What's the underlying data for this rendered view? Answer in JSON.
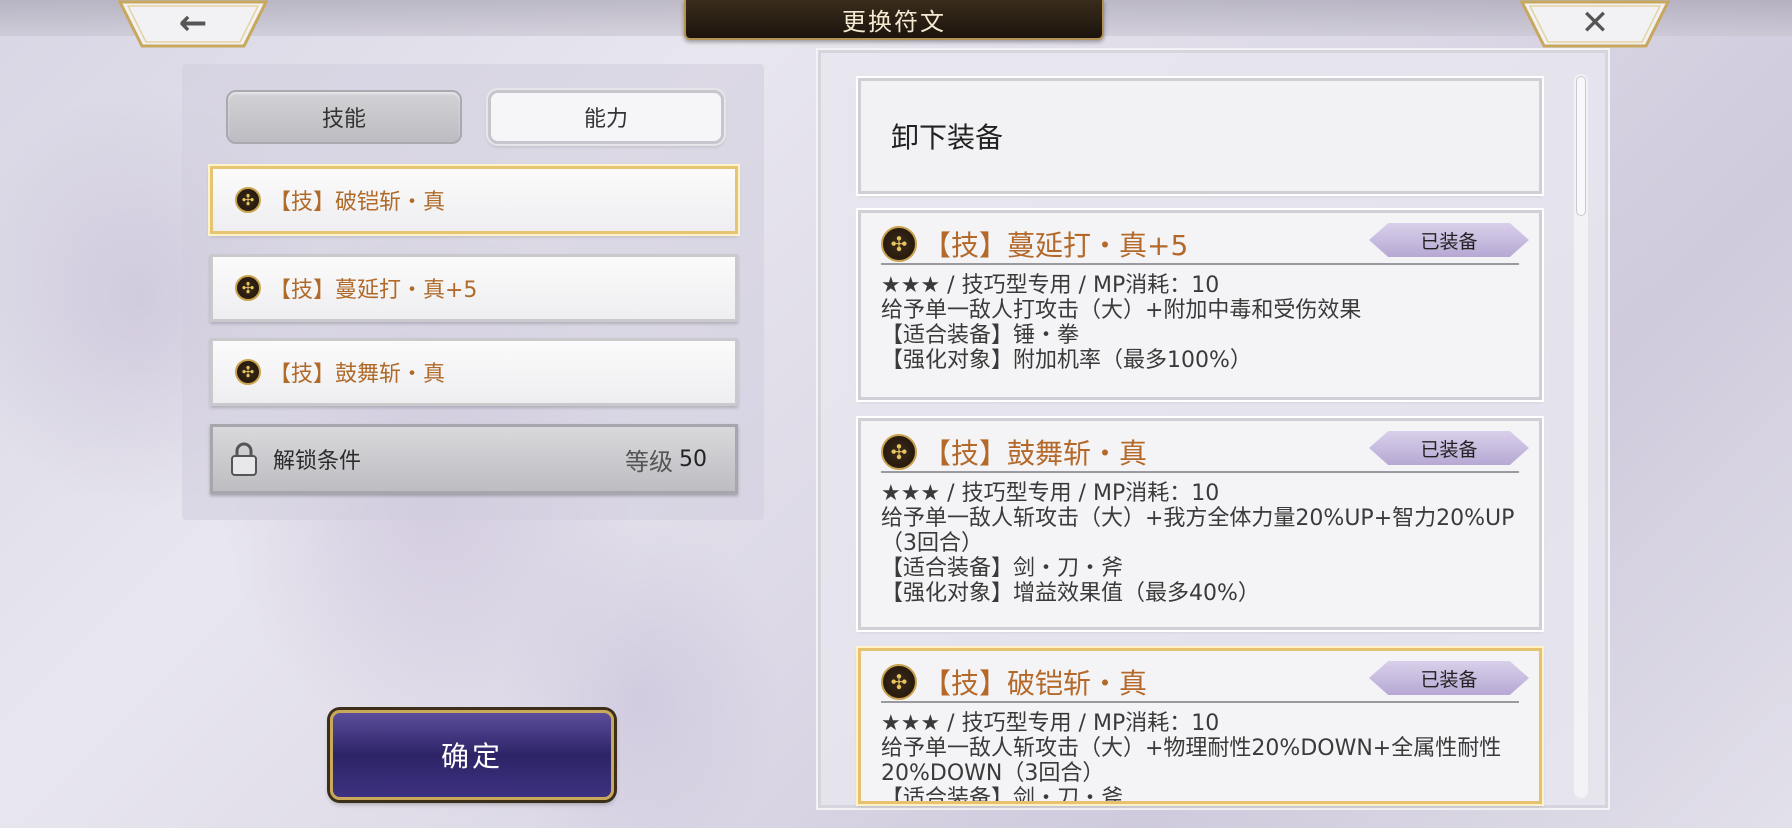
{
  "header": {
    "title": "更换符文",
    "back_glyph": "←",
    "close_glyph": "✕"
  },
  "tabs": [
    {
      "label": "技能",
      "active": false
    },
    {
      "label": "能力",
      "active": true
    }
  ],
  "slots": [
    {
      "icon": "rune-icon",
      "label": "【技】破铠斩・真",
      "selected": true
    },
    {
      "icon": "rune-icon",
      "label": "【技】蔓延打・真+5",
      "selected": false
    },
    {
      "icon": "rune-icon",
      "label": "【技】鼓舞斩・真",
      "selected": false
    }
  ],
  "lock": {
    "label": "解锁条件",
    "level_label": "等级",
    "level_value": "50"
  },
  "confirm_label": "确定",
  "unequip_label": "卸下装备",
  "cards": [
    {
      "name": "【技】蔓延打・真+5",
      "badge": "已装备",
      "lines": [
        "★★★ / 技巧型专用 / MP消耗：10",
        "给予单一敌人打攻击（大）+附加中毒和受伤效果",
        "【适合装备】锤・拳",
        "【强化对象】附加机率（最多100%）"
      ]
    },
    {
      "name": "【技】鼓舞斩・真",
      "badge": "已装备",
      "lines": [
        "★★★ / 技巧型专用 / MP消耗：10",
        "给予单一敌人斩攻击（大）+我方全体力量20%UP+智力20%UP（3回合）",
        "【适合装备】剑・刀・斧",
        "【强化对象】增益效果值（最多40%）"
      ]
    },
    {
      "name": "【技】破铠斩・真",
      "badge": "已装备",
      "lines": [
        "★★★ / 技巧型专用 / MP消耗：10",
        "给予单一敌人斩攻击（大）+物理耐性20%DOWN+全属性耐性20%DOWN（3回合）",
        "【适合装备】剑・刀・斧"
      ]
    }
  ],
  "colors": {
    "skill_name": "#b4692a",
    "selected_border": "#e6c26f",
    "badge": "#b7a8d4",
    "confirm": "#2d2466"
  }
}
